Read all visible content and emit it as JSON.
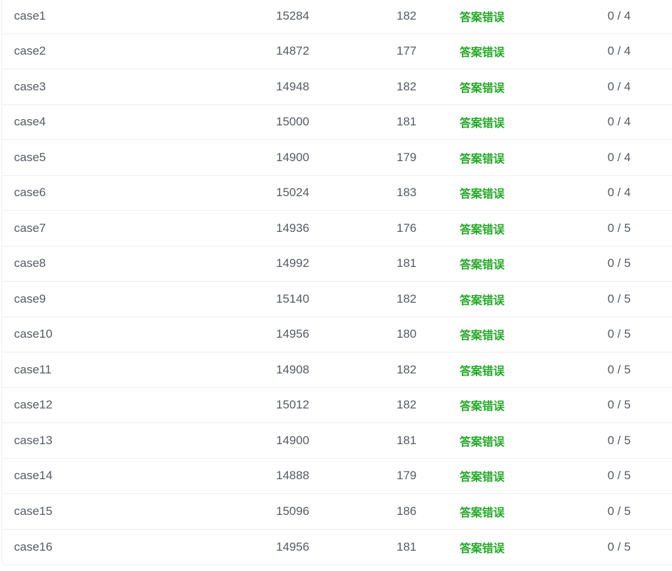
{
  "testcases": [
    {
      "name": "case1",
      "time": "15284",
      "memory": "182",
      "status": "答案错误",
      "score": "0 / 4"
    },
    {
      "name": "case2",
      "time": "14872",
      "memory": "177",
      "status": "答案错误",
      "score": "0 / 4"
    },
    {
      "name": "case3",
      "time": "14948",
      "memory": "182",
      "status": "答案错误",
      "score": "0 / 4"
    },
    {
      "name": "case4",
      "time": "15000",
      "memory": "181",
      "status": "答案错误",
      "score": "0 / 4"
    },
    {
      "name": "case5",
      "time": "14900",
      "memory": "179",
      "status": "答案错误",
      "score": "0 / 4"
    },
    {
      "name": "case6",
      "time": "15024",
      "memory": "183",
      "status": "答案错误",
      "score": "0 / 4"
    },
    {
      "name": "case7",
      "time": "14936",
      "memory": "176",
      "status": "答案错误",
      "score": "0 / 5"
    },
    {
      "name": "case8",
      "time": "14992",
      "memory": "181",
      "status": "答案错误",
      "score": "0 / 5"
    },
    {
      "name": "case9",
      "time": "15140",
      "memory": "182",
      "status": "答案错误",
      "score": "0 / 5"
    },
    {
      "name": "case10",
      "time": "14956",
      "memory": "180",
      "status": "答案错误",
      "score": "0 / 5"
    },
    {
      "name": "case11",
      "time": "14908",
      "memory": "182",
      "status": "答案错误",
      "score": "0 / 5"
    },
    {
      "name": "case12",
      "time": "15012",
      "memory": "182",
      "status": "答案错误",
      "score": "0 / 5"
    },
    {
      "name": "case13",
      "time": "14900",
      "memory": "181",
      "status": "答案错误",
      "score": "0 / 5"
    },
    {
      "name": "case14",
      "time": "14888",
      "memory": "179",
      "status": "答案错误",
      "score": "0 / 5"
    },
    {
      "name": "case15",
      "time": "15096",
      "memory": "186",
      "status": "答案错误",
      "score": "0 / 5"
    },
    {
      "name": "case16",
      "time": "14956",
      "memory": "181",
      "status": "答案错误",
      "score": "0 / 5"
    }
  ],
  "colors": {
    "status_wrong": "#23a826",
    "text": "#555a63",
    "border": "#ebeef5"
  }
}
